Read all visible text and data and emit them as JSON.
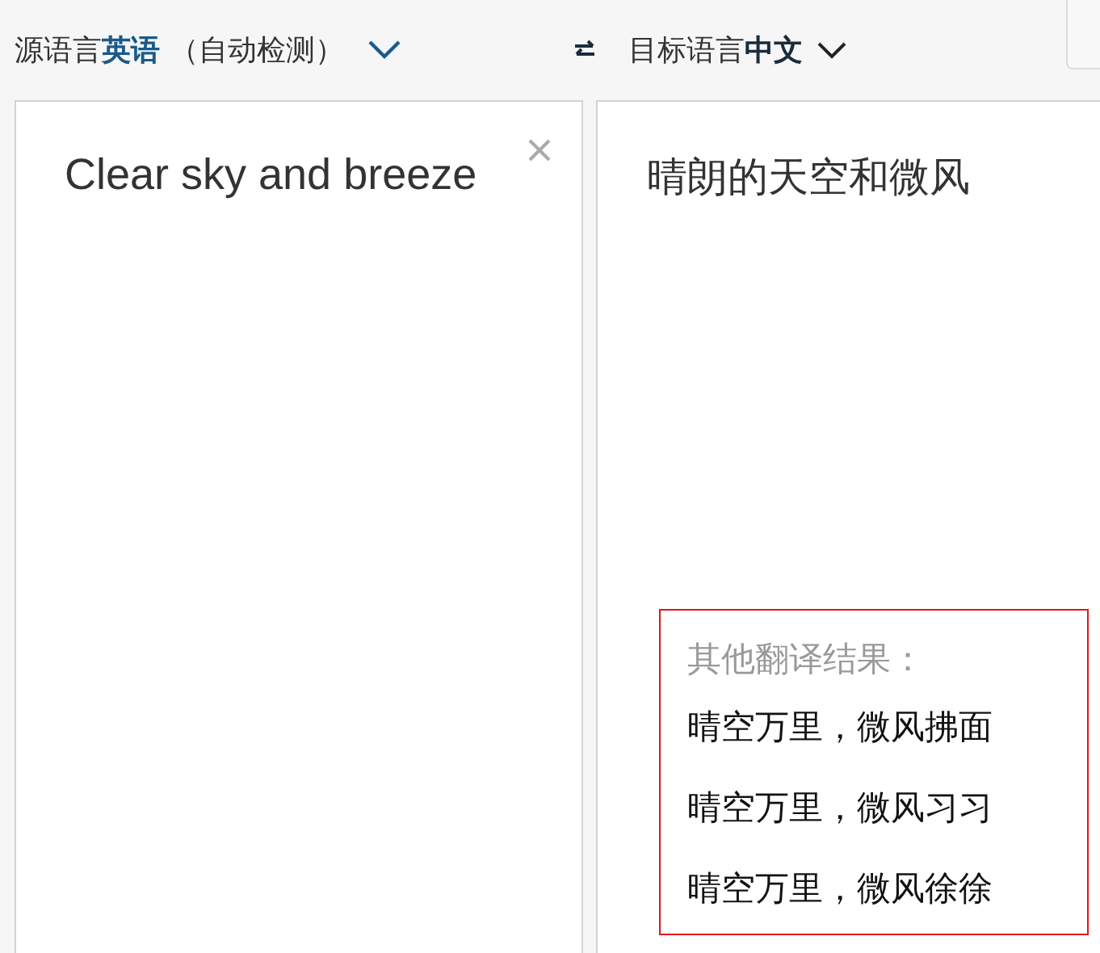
{
  "source_language": {
    "label": "源语言",
    "language": "英语",
    "note": "（自动检测）"
  },
  "target_language": {
    "label": "目标语言",
    "language": "中文"
  },
  "input": {
    "value": "Clear sky and breeze"
  },
  "output": {
    "text": "晴朗的天空和微风"
  },
  "alternatives": {
    "heading": "其他翻译结果：",
    "items": [
      "晴空万里，微风拂面",
      "晴空万里，微风习习",
      "晴空万里，微风徐徐"
    ]
  }
}
